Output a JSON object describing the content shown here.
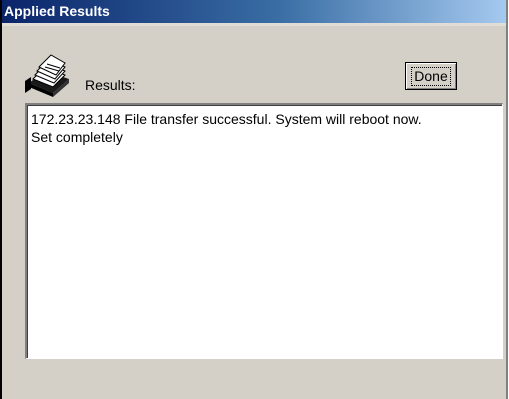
{
  "window": {
    "title": "Applied Results"
  },
  "header": {
    "icon": "card-file-icon",
    "results_label": "Results:",
    "done_label": "Done"
  },
  "results": {
    "lines": [
      "172.23.23.148 File transfer successful. System will reboot now.",
      "Set completely"
    ]
  }
}
